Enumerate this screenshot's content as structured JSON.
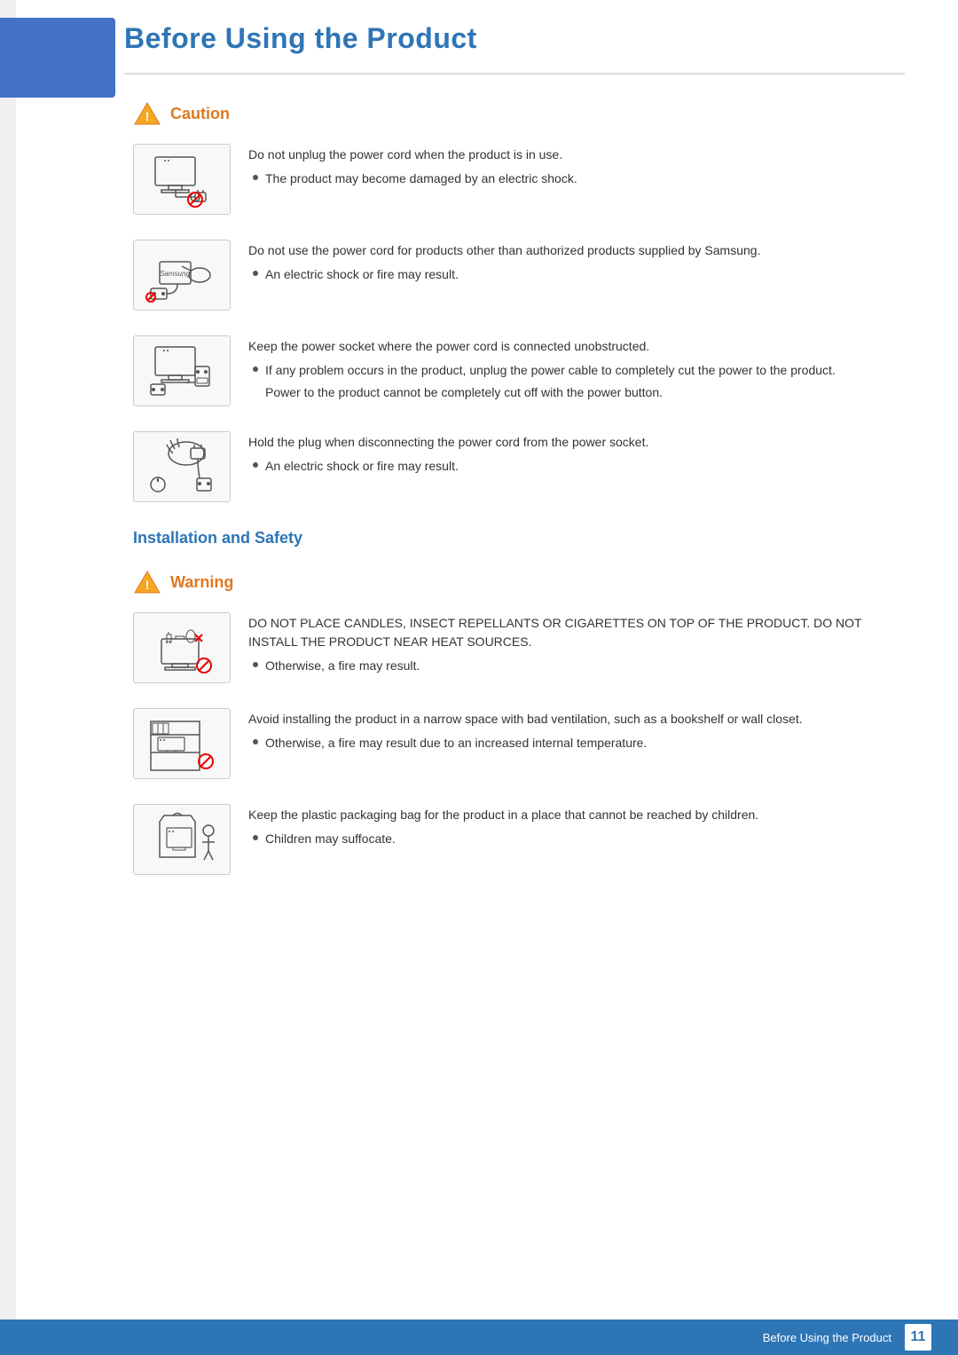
{
  "page": {
    "title": "Before Using the Product",
    "page_number": "11",
    "footer_label": "Before Using the Product"
  },
  "caution_section": {
    "label": "Caution",
    "items": [
      {
        "id": "item1",
        "main_text": "Do not unplug the power cord when the product is in use.",
        "bullets": [
          "The product may become damaged by an electric shock."
        ],
        "sub_notes": []
      },
      {
        "id": "item2",
        "main_text": "Do not use the power cord for products other than authorized products supplied by Samsung.",
        "bullets": [
          "An electric shock or fire may result."
        ],
        "sub_notes": []
      },
      {
        "id": "item3",
        "main_text": "Keep the power socket where the power cord is connected unobstructed.",
        "bullets": [
          "If any problem occurs in the product, unplug the power cable to completely cut the power to the product."
        ],
        "sub_notes": [
          "Power to the product cannot be completely cut off with the power button."
        ]
      },
      {
        "id": "item4",
        "main_text": "Hold the plug when disconnecting the power cord from the power socket.",
        "bullets": [
          "An electric shock or fire may result."
        ],
        "sub_notes": []
      }
    ]
  },
  "installation_section": {
    "title": "Installation and Safety",
    "label": "Warning",
    "items": [
      {
        "id": "warn1",
        "main_text": "DO NOT PLACE CANDLES, INSECT REPELLANTS OR CIGARETTES ON TOP OF THE PRODUCT. DO NOT INSTALL THE PRODUCT NEAR HEAT SOURCES.",
        "bullets": [
          "Otherwise, a fire may result."
        ],
        "sub_notes": []
      },
      {
        "id": "warn2",
        "main_text": "Avoid installing the product in a narrow space with bad ventilation, such as a bookshelf or wall closet.",
        "bullets": [
          "Otherwise, a fire may result due to an increased internal temperature."
        ],
        "sub_notes": []
      },
      {
        "id": "warn3",
        "main_text": "Keep the plastic packaging bag for the product in a place that cannot be reached by children.",
        "bullets": [
          "Children may suffocate."
        ],
        "sub_notes": []
      }
    ]
  }
}
